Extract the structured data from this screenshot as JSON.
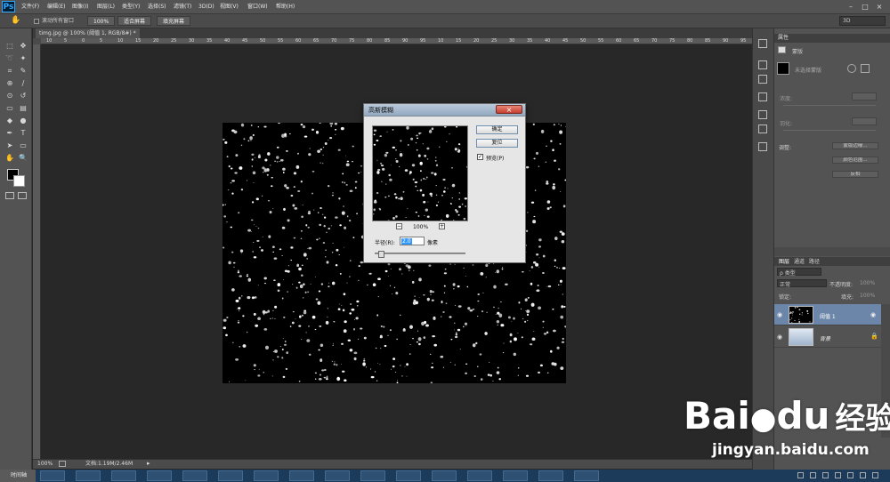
{
  "app": {
    "logo": "Ps"
  },
  "menubar": {
    "items": [
      "文件(F)",
      "编辑(E)",
      "图像(I)",
      "图层(L)",
      "类型(Y)",
      "选择(S)",
      "滤镜(T)",
      "3D(D)",
      "视图(V)",
      "窗口(W)",
      "帮助(H)"
    ]
  },
  "options_bar": {
    "scroll_all_windows": "滚动所有窗口",
    "btn_100": "100%",
    "btn_fit_screen": "适合屏幕",
    "btn_fill_screen": "填充屏幕",
    "workspace": "3D"
  },
  "document": {
    "tab_title": "timg.jpg @ 100% (阈值 1, RGB/8#) *",
    "zoom": "100%",
    "doc_info": "文档:1.19M/2.46M"
  },
  "rulers": {
    "h_ticks": [
      "10",
      "5",
      "0",
      "5",
      "10",
      "15",
      "20",
      "25",
      "30",
      "35",
      "40",
      "45",
      "50",
      "55",
      "60",
      "65",
      "70",
      "75",
      "80",
      "85",
      "90",
      "95",
      "10",
      "15",
      "20",
      "25",
      "30",
      "35",
      "40",
      "45",
      "50",
      "55",
      "60",
      "65",
      "70",
      "75",
      "80",
      "85",
      "90",
      "95"
    ]
  },
  "timeline": {
    "label": "时间轴"
  },
  "properties_panel": {
    "tab": "属性",
    "subtitle": "蒙版",
    "mask_label": "未选择蒙版",
    "density_label": "浓度:",
    "feather_label": "羽化:",
    "adjust_label": "调整:",
    "btn_mask_edge": "蒙版边缘...",
    "btn_color_range": "颜色范围...",
    "btn_invert": "反相"
  },
  "layers_panel": {
    "tabs": [
      "图层",
      "通道",
      "路径"
    ],
    "filter_label": "ρ 类型",
    "blend_mode": "正常",
    "opacity_label": "不透明度:",
    "opacity_value": "100%",
    "lock_label": "锁定:",
    "fill_label": "填充:",
    "fill_value": "100%",
    "layers": [
      {
        "name": "阈值 1",
        "selected": true
      },
      {
        "name": "背景",
        "selected": false
      }
    ]
  },
  "dialog": {
    "title": "高斯模糊",
    "ok": "确定",
    "reset": "复位",
    "preview_label": "预览(P)",
    "preview_checked": true,
    "zoom_value": "100%",
    "zoom_out": "−",
    "zoom_in": "+",
    "radius_label": "半径(R):",
    "radius_value": "2.0",
    "radius_unit": "像素",
    "slider_level": 0.04
  },
  "watermark": {
    "brand": "Bai",
    "brand2": "du",
    "cn": "经验",
    "url": "jingyan.baidu.com"
  },
  "colors": {
    "accent_selected_layer": "#6b86a8",
    "ps_blue": "#31a8ff"
  }
}
